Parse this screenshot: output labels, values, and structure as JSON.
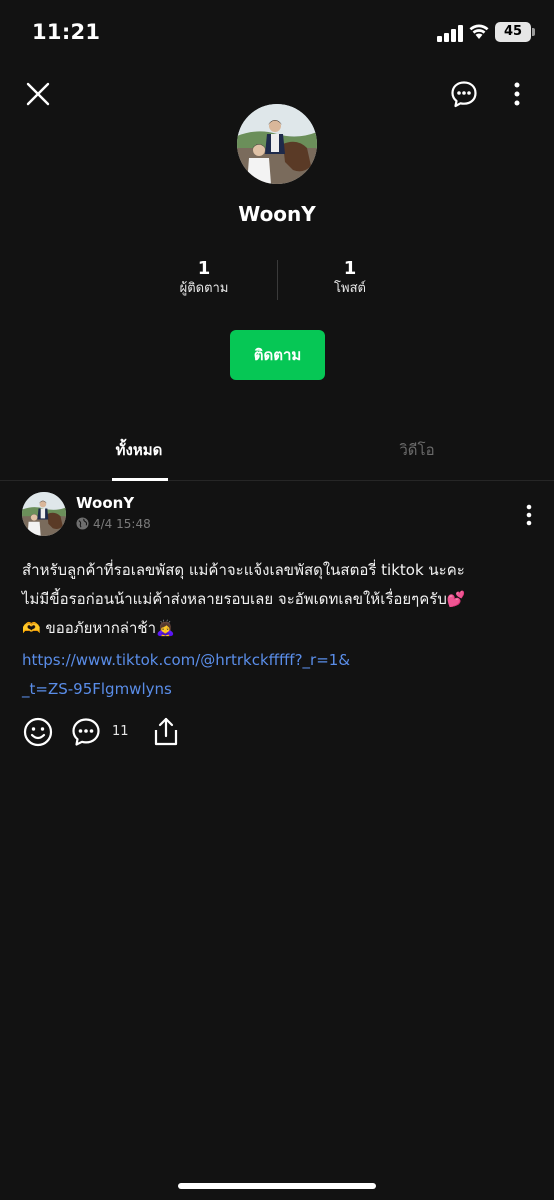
{
  "status_bar": {
    "time": "11:21",
    "battery": "45"
  },
  "profile": {
    "name": "WoonY",
    "followers_count": "1",
    "followers_label": "ผู้ติดตาม",
    "posts_count": "1",
    "posts_label": "โพสต์",
    "follow_button": "ติดตาม"
  },
  "tabs": [
    {
      "label": "ทั้งหมด",
      "active": true
    },
    {
      "label": "วิดีโอ",
      "active": false
    }
  ],
  "post": {
    "author": "WoonY",
    "timestamp": "4/4 15:48",
    "text_lines": [
      "สำหรับลูกค้าที่รอเลขพัสดุ แม่ค้าจะแจ้งเลขพัสดุในสตอรี่ tiktok นะคะ",
      "ไม่มีขี้อรอก่อนน้าแม่ค้าส่งหลายรอบเลย จะอัพเดทเลขให้เรื่อยๆครับ💕",
      "🫶 ขออภัยหากล่าช้า🙇‍♀️"
    ],
    "link": "https://www.tiktok.com/@hrtrkckfffff?_r=1&_t=ZS-95Flgmwlyns",
    "comment_count": "11"
  },
  "colors": {
    "background": "#121212",
    "accent_green": "#06c755",
    "link_blue": "#5a8de8"
  },
  "icons": [
    "close-icon",
    "chat-icon",
    "more-vertical-icon",
    "globe-icon",
    "smile-icon",
    "comment-icon",
    "share-icon"
  ]
}
